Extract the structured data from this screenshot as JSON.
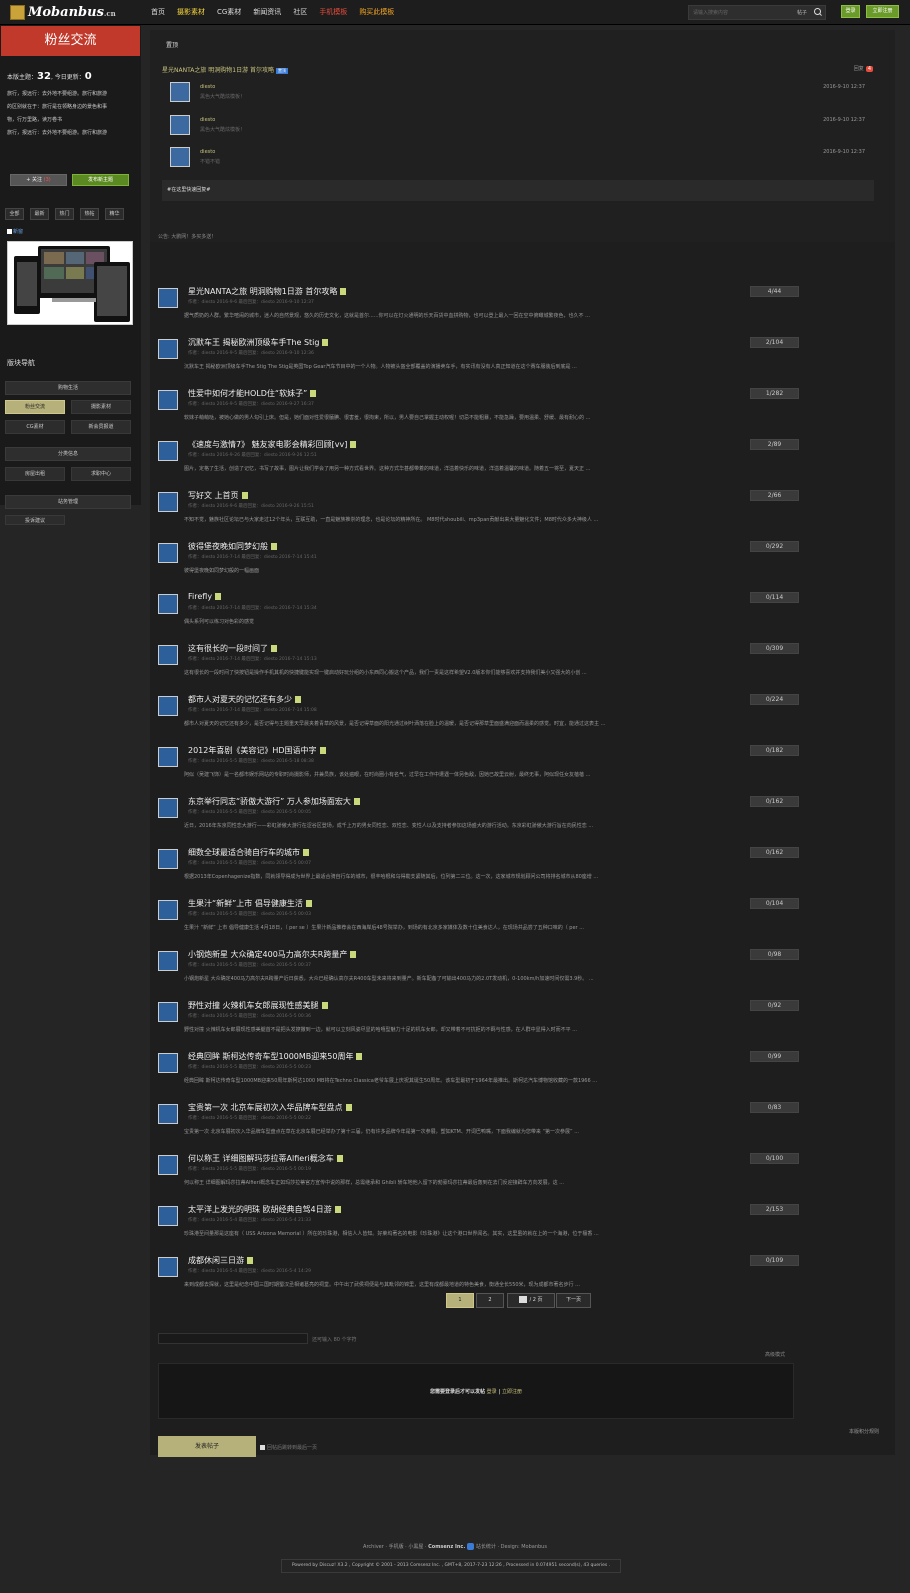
{
  "header": {
    "logo_text": "Mobanbus",
    "logo_suffix": ".cn",
    "nav": [
      {
        "label": "首页",
        "color": "#dddddd"
      },
      {
        "label": "摄影素材",
        "color": "#f5d43a"
      },
      {
        "label": "CG素材",
        "color": "#dddddd"
      },
      {
        "label": "新闻资讯",
        "color": "#dddddd"
      },
      {
        "label": "社区",
        "color": "#dddddd"
      },
      {
        "label": "手机模板",
        "color": "#e74c3c"
      },
      {
        "label": "购买此模板",
        "color": "#f5a623"
      }
    ],
    "search_placeholder": "请输入搜索内容",
    "search_type": "帖子",
    "login_label": "登录",
    "register_label": "立即注册"
  },
  "sidebar": {
    "forum_name": "粉丝交流",
    "stats_prefix": "本版主题：",
    "topics": "32",
    "stats_mid": ", 今日更新：",
    "today": "0",
    "rules": [
      "旅行，报远行：去外地不要组游。旅行和旅游",
      "的区别就在于：旅行是在领略身边的景色和事",
      "物，行万里路，读万卷书",
      "旅行，报远行：去外地不要组游。旅行和旅游"
    ],
    "follow_label": "+ 关注",
    "follow_count": "(3)",
    "post_label": "发布新主题",
    "filters": [
      "全部",
      "最新",
      "热门",
      "热帖",
      "精华"
    ],
    "new_label": "新窗",
    "section_title": "版块导航",
    "groups": [
      {
        "title": "购物生活",
        "links": [
          "粉丝交流",
          "摄影素材",
          "CG素材",
          "新会员报道"
        ]
      },
      {
        "title": "分类信息",
        "links": [
          "房屋出租",
          "求职中心"
        ]
      },
      {
        "title": "站务管理",
        "links": [
          "投诉建议"
        ]
      }
    ]
  },
  "sticky": {
    "header": "置顶",
    "title": "星光NANTA之旅 明洞购物1日游 首尔攻略",
    "badge": "置顶",
    "reply_label": "回复",
    "reply_count": "4",
    "replies": [
      {
        "user": "diesto",
        "msg": "黑色大气酷炫模板！",
        "date": "2016-9-10 12:37"
      },
      {
        "user": "diesto",
        "msg": "黑色大气酷炫模板！",
        "date": "2016-9-10 12:37"
      },
      {
        "user": "diesto",
        "msg": "不错不错",
        "date": "2016-9-10 12:37"
      }
    ],
    "quick_reply": "#在这里快速回复#"
  },
  "notice": "公告: 大鹏网！多买多送！",
  "threads": [
    {
      "title": "星光NANTA之旅 明洞购物1日游 首尔攻略",
      "meta": "作者：diesto 2016-9-6   最后回复：diesto 2016-9-10 12:37",
      "excerpt": "据气质奶的人群。繁华喧闹的城市，迷人的自然景观，悠久的历史文化，这就是首尔......你可以在灯火通明的乐天百货中血拼购物，也可以登上最入一回在空中俯瞰城繁夜色，也久不 ...",
      "count": "4/44"
    },
    {
      "title": "沉默车王 揭秘欧洲顶级车手The Stig",
      "meta": "作者：diesto 2016-9-5   最后回复：diesto 2016-9-10 12:36",
      "excerpt": "沉默车王 揭秘欧洲顶级车手The Stig The Stig是英国Top Gear汽车节目中的一个人物。人物被头盔全部覆盖的演播卖车手，有实讯有没有人真正知道在这个赛车服装后到底是 ...",
      "count": "2/104"
    },
    {
      "title": "性爱中如何才能HOLD住“软妹子”",
      "meta": "作者：diesto 2016-9-5   最后回复：diesto 2016-9-27 16:37",
      "excerpt": "软妹子萌萌哒，被她心做的男人勾引上床。但是，她们面对性爱很腼腆、很害羞，很拘束，所以，男人要自己掌握主动权喔！切忌不能粗暴，不能急躁，要用温柔、舒缓、最有耐心的 ...",
      "count": "1/282"
    },
    {
      "title": "《速度与激情7》 魅友家电影会精彩回顾[vv]",
      "meta": "作者：diesto 2016-9-26   最后回复：diesto 2016-9-26 12:51",
      "excerpt": "图片，定格了生活，创造了记忆，书写了故事，图片让我们学会了用另一种方式看世界。这种方式华甚都带着的味道，洋溢着快乐的味道，洋溢着温馨的味道。随着五一将至，夏天正 ...",
      "count": "2/89"
    },
    {
      "title": "写好文 上首页",
      "meta": "作者：diesto 2016-9-6   最后回复：diesto 2016-9-26 15:51",
      "excerpt": "不知不觉，魅族社区论坛已与大家走过12个年头，互联互助，一直是魅族推崇的理念，也是论坛的精神所在。 M8时代shoubili、mp3pan贡献出来大量魅化文件；M8时代众多大神级人 ...",
      "count": "2/66"
    },
    {
      "title": "彼得堡夜晚如同梦幻般",
      "meta": "作者：diesto 2016-7-14   最后回复：diesto 2016-7-14 15:41",
      "excerpt": "彼得堡夜晚如同梦幻般的一幅画面",
      "count": "0/292"
    },
    {
      "title": "Firefly",
      "meta": "作者：diesto 2016-7-14   最后回复：diesto 2016-7-14 15:34",
      "excerpt": "偶头系列可以练习对色彩的感觉",
      "count": "0/114"
    },
    {
      "title": "这有很长的一段时间了",
      "meta": "作者：diesto 2016-7-14   最后回复：diesto 2016-7-14 15:13",
      "excerpt": "这有很长的一段时间了快按钮是操作手机其机的快捷键能实现一键启动好玩分组的小东西同心搬这个产品，我们一责是这样希望V2.0版本你们能够喜欢并支持我们美小又强大的小创 ...",
      "count": "0/309"
    },
    {
      "title": "都市人对夏天的记忆还有多少",
      "meta": "作者：diesto 2016-7-14   最后回复：diesto 2016-7-14 15:08",
      "excerpt": "都市人对夏天的记忆还有多少，是否记得与主题重天早晨夹着青草的风景，是否记得草面的阳光通过树叶洒落在脸上的温暖，是否记得那草里面盛满迎面而温柔的感觉。时宜，能通过这表主 ...",
      "count": "0/224"
    },
    {
      "title": "2012年喜剧《美容记》HD国语中字",
      "meta": "作者：diesto 2016-5-5   最后回复：diesto 2016-5-18 08:38",
      "excerpt": "阿似（吴建飞饰）是一名都市娱乐网站的专职时尚摄影师，并兼员族，该处遍眼，在时尚圈小有名气，过早在工作中遭遇一体另色敌，因她已故里云射，最终无事，阿似现任女友蓓蓓 ...",
      "count": "0/182"
    },
    {
      "title": "东京举行同志“骄傲大游行” 万人参加场面宏大",
      "meta": "作者：diesto 2016-5-5   最后回复：diesto 2016-5-5 00:05",
      "excerpt": "近日，2016年东京同性恋大游行——彩虹骄傲大游行在涩谷区登场，成千上万的男女同性恋、双性恋、变性人以及支持者参加这场盛大的游行活动。东京彩虹骄傲大游行旨在向民性恋 ...",
      "count": "0/162"
    },
    {
      "title": "细数全球最适合骑自行车的城市",
      "meta": "作者：diesto 2016-5-5   最后回复：diesto 2016-5-5 00:07",
      "excerpt": "根据2013年Copenhagenize指数，同就领导得成为世界上最适合骑自行车的城市，很丰哈根和乌得勒支紧随其后，位列第二三位。这一次，这家城市规划顾问公司将排名城市从80座增 ...",
      "count": "0/162"
    },
    {
      "title": "生果汁“新鲜”上市 倡导健康生活",
      "meta": "作者：diesto 2016-5-5   最后回复：diesto 2016-5-5 00:03",
      "excerpt": "生果汁 “新鲜” 上市 倡导健康生活 4月18日，（ per se ）生果汁新品推荐会在西海岸后48号院举办，到场的有北京多家媒体及数十位美食达人，在现场共品尝了五种口味的（ per ...",
      "count": "0/104"
    },
    {
      "title": "小钢炮新星 大众确定400马力高尔夫R跨量产",
      "meta": "作者：diesto 2016-5-5   最后回复：diesto 2016-5-5 00:37",
      "excerpt": "小钢炮新星 大众确定400马力高尔夫R跨量产近日获悉，大众已经确认高尔夫R400车型未来将来到量产。新车配备了可输出400马力的2.0T发动机，0-100km/h加速时间仅需3.9秒。 ...",
      "count": "0/98"
    },
    {
      "title": "野性对撞 火辣机车女郎展现性感美腿",
      "meta": "作者：diesto 2016-5-5   最后回复：diesto 2016-5-5 00:36",
      "excerpt": "野性对撞 火辣机车女郎展现性感美腿首不是把头发撩撒到一边，就可以立刻风姿尽显的哈嘻型魅力十足的机车女郎，却又带着不可抗拒的不羁与性感，在人群中显得入时而不平 ...",
      "count": "0/92"
    },
    {
      "title": "经典回眸 斯柯达传奇车型1000MB迎来50周年",
      "meta": "作者：diesto 2016-5-5   最后回复：diesto 2016-5-5 00:23",
      "excerpt": "经典回眸 斯柯达传奇车型1000MB迎来50周年斯柯达1000 MB将在Techno Classica老爷车展上庆祝其诞生50周年。该车型最初于1964年最推出。斯柯达汽车博物馆收藏的一款1966 ...",
      "count": "0/99"
    },
    {
      "title": "宝贵第一次 北京车展初次入华品牌车型盘点",
      "meta": "作者：diesto 2016-5-5   最后回复：diesto 2016-5-5 00:22",
      "excerpt": "宝贵第一次 北京车展初次入华品牌车型盘点在草在北京车展已经举办了第十三届，仍有许多品牌今年是第一次参展，塑如KTM、开词巴鸭嘴，下面我编就为您带来 “第一次参展” ...",
      "count": "0/83"
    },
    {
      "title": "何以称王 详细图解玛莎拉蒂Alfieri概念车",
      "meta": "作者：diesto 2016-5-5   最后回复：diesto 2016-5-5 00:19",
      "excerpt": "何以称王 详细图解玛莎拉蒂Alfieri概念车正如玛莎拉蒂官方宣传中说的那样，总需继承和 Ghibli 轿车地他入留下的勃豪玛莎拉蒂最后轰到在去门反迎接辟车方向发展，这 ...",
      "count": "0/100"
    },
    {
      "title": "太平洋上发光的明珠 欧胡经典自驾4日游",
      "meta": "作者：diesto 2016-5-4   最后回复：diesto 2016-5-4 21:33",
      "excerpt": "珍珠港至间量那是这座有（ USS Arizona Memorial ）所在的珍珠港，相信人人皆知。好莱坞著名的电影《珍珠港》让这个港口世界闻名。其实，这里虽的就在上的一个海港，位于檀香 ...",
      "count": "2/153"
    },
    {
      "title": "成都休闲三日游",
      "meta": "作者：diesto 2016-5-4   最后回复：diesto 2016-5-4 14:29",
      "excerpt": "来到成都去探就，这里是纪念中国三国时期蜀汉丞相诸葛亮的祠堂。中午出了武侯祠便是与其毗邻的锦里，这里有成都最地道的特色美食，衡通全长550米，现为成都市著名步行 ...",
      "count": "0/109"
    }
  ],
  "pager": {
    "p1": "1",
    "p2": "2",
    "total": "/ 2 页",
    "next": "下一页"
  },
  "reply": {
    "title_hint": "还可输入 80 个字符",
    "advanced": "高级模式",
    "login_prompt": "您需要登录后才可以发帖",
    "login": "登录",
    "sep": " | ",
    "register": "立即注册",
    "credit_rule": "本版积分规则",
    "submit": "发表帖子",
    "checkbox": "回帖后跳转到最后一页"
  },
  "footer": {
    "links": "Archiver · 手机版 · 小黑屋 · ",
    "company": "Comsenz Inc.",
    "stat": "站长统计",
    "design": " · Design: Mobanbus",
    "powered": "Powered by Discuz! X3.2 , Copyright © 2001 - 2013 Comsenz Inc. , GMT+8, 2017-7-23 12:26 , Processed in 0.074951 second(s), 43 queries ."
  }
}
